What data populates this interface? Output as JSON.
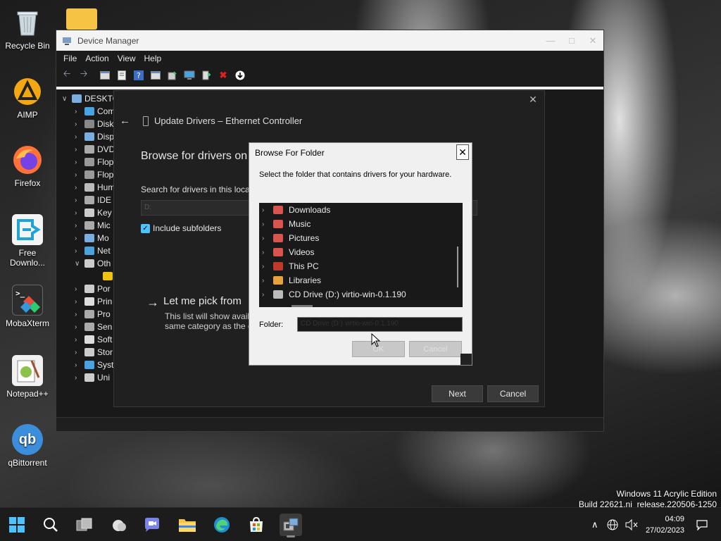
{
  "desktop": {
    "icons": [
      {
        "label": "Recycle Bin",
        "icon": "recycle-bin-icon"
      },
      {
        "label": "AIMP",
        "icon": "aimp-icon"
      },
      {
        "label": "Firefox",
        "icon": "firefox-icon"
      },
      {
        "label": "Free Downlo...",
        "icon": "free-download-manager-icon"
      },
      {
        "label": "MobaXterm",
        "icon": "mobaxterm-icon"
      },
      {
        "label": "Notepad++",
        "icon": "notepadpp-icon"
      },
      {
        "label": "qBittorrent",
        "icon": "qbittorrent-icon",
        "glyph": "qb"
      }
    ]
  },
  "device_manager": {
    "title": "Device Manager",
    "menu": [
      "File",
      "Action",
      "View",
      "Help"
    ],
    "tree": {
      "root": "DESKTO",
      "items": [
        "Com",
        "Disk",
        "Disp",
        "DVD",
        "Flop",
        "Flop",
        "Hum",
        "IDE",
        "Key",
        "Mic",
        "Mo",
        "Net",
        "Oth",
        "",
        "Por",
        "Prin",
        "Pro",
        "Sen",
        "Soft",
        "Stor",
        "Syst",
        "Uni"
      ]
    }
  },
  "wizard": {
    "header": "Update Drivers – Ethernet Controller",
    "heading": "Browse for drivers on",
    "search_label": "Search for drivers in this loca",
    "search_value": "D:",
    "include_subfolders": "Include subfolders",
    "pick_title": "Let me pick from",
    "pick_desc_line1": "This list will show avail",
    "pick_desc_line2": "same category as the d",
    "next": "Next",
    "cancel": "Cancel"
  },
  "browse_dialog": {
    "title": "Browse For Folder",
    "description": "Select the folder that contains drivers for your hardware.",
    "folders": [
      {
        "label": "Downloads",
        "color": "#d9534f"
      },
      {
        "label": "Music",
        "color": "#d9534f"
      },
      {
        "label": "Pictures",
        "color": "#d9534f"
      },
      {
        "label": "Videos",
        "color": "#d9534f"
      },
      {
        "label": "This PC",
        "color": "#c0392b"
      },
      {
        "label": "Libraries",
        "color": "#e6a23c"
      },
      {
        "label": "CD Drive (D:) virtio-win-0.1.190",
        "color": "#bbbbbb"
      }
    ],
    "folder_label": "Folder:",
    "folder_value": "CD Drive (D:) virtio-win-0.1.190",
    "ok": "OK",
    "cancel": "Cancel"
  },
  "watermark": {
    "line1": "Windows 11 Acrylic Edition",
    "line2": "Build 22621.ni_release.220506-1250"
  },
  "taskbar": {
    "apps": [
      "start-icon",
      "search-icon",
      "task-view-icon",
      "weather-icon",
      "teams-chat-icon",
      "file-explorer-icon",
      "edge-icon",
      "store-icon",
      "device-manager-icon"
    ],
    "time": "04:09",
    "date": "27/02/2023"
  }
}
